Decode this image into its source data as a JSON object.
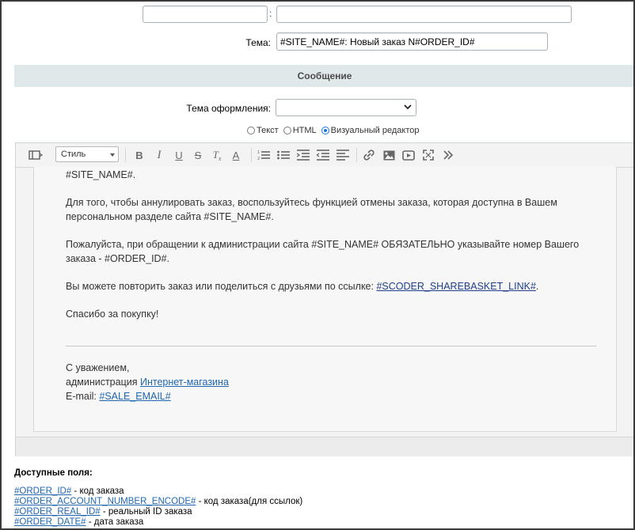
{
  "theme_label": "Тема:",
  "theme_value": "#SITE_NAME#: Новый заказ N#ORDER_ID#",
  "section_title": "Сообщение",
  "design_theme_label": "Тема оформления:",
  "design_theme_selected": "",
  "format_options": [
    {
      "label": "Текст",
      "checked": false
    },
    {
      "label": "HTML",
      "checked": false
    },
    {
      "label": "Визуальный редактор",
      "checked": true
    }
  ],
  "toolbar": {
    "style_select": "Стиль",
    "icons": [
      "source-toggle-icon",
      "bold-icon",
      "italic-icon",
      "underline-icon",
      "strikethrough-icon",
      "remove-format-icon",
      "text-color-icon",
      "ordered-list-icon",
      "unordered-list-icon",
      "outdent-icon",
      "indent-icon",
      "align-left-icon",
      "link-icon",
      "image-icon",
      "video-icon",
      "fullscreen-icon",
      "more-icon"
    ]
  },
  "body": {
    "line1": "#SITE_NAME#.",
    "cancel_p1": "Для того, чтобы аннулировать заказ, воспользуйтесь функцией отмены заказа, которая доступна в Вашем",
    "cancel_p2": "персональном разделе сайта #SITE_NAME#.",
    "contact_p1": "Пожалуйста, при обращении к администрации сайта #SITE_NAME# ОБЯЗАТЕЛЬНО указывайте номер Вашего",
    "contact_p2": "заказа - #ORDER_ID#.",
    "share_text": "Вы можете повторить заказ или поделиться с друзьями по ссылке: ",
    "share_link": "#SCODER_SHAREBASKET_LINK#",
    "share_end": ".",
    "thanks": "Спасибо за покупку!",
    "regards": "С уважением,",
    "admin_text": "администрация ",
    "admin_link": "Интернет-магазина",
    "email_label": "E-mail: ",
    "email_link": "#SALE_EMAIL#"
  },
  "fields": {
    "title": "Доступные поля:",
    "items": [
      {
        "code": "#ORDER_ID#",
        "desc": " - код заказа"
      },
      {
        "code": "#ORDER_ACCOUNT_NUMBER_ENCODE#",
        "desc": " - код заказа(для ссылок)"
      },
      {
        "code": "#ORDER_REAL_ID#",
        "desc": " - реальный ID заказа"
      },
      {
        "code": "#ORDER_DATE#",
        "desc": " - дата заказа"
      }
    ]
  },
  "colors": {
    "section_header_bg": "#e0e8ea",
    "link": "#2067b0",
    "radio_accent": "#1a73e8"
  }
}
